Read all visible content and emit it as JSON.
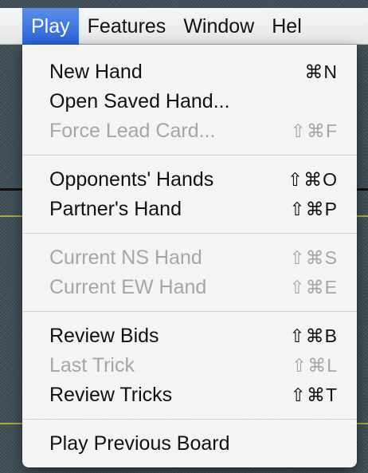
{
  "menubar": {
    "items": [
      {
        "label": "Play",
        "active": true
      },
      {
        "label": "Features"
      },
      {
        "label": "Window"
      },
      {
        "label": "Hel"
      }
    ]
  },
  "menu": {
    "groups": [
      [
        {
          "label": "New Hand",
          "shortcut": "⌘N",
          "enabled": true
        },
        {
          "label": "Open Saved Hand...",
          "shortcut": "",
          "enabled": true
        },
        {
          "label": "Force Lead Card...",
          "shortcut": "⇧⌘F",
          "enabled": false
        }
      ],
      [
        {
          "label": "Opponents' Hands",
          "shortcut": "⇧⌘O",
          "enabled": true
        },
        {
          "label": "Partner's Hand",
          "shortcut": "⇧⌘P",
          "enabled": true
        }
      ],
      [
        {
          "label": "Current NS Hand",
          "shortcut": "⇧⌘S",
          "enabled": false
        },
        {
          "label": "Current EW Hand",
          "shortcut": "⇧⌘E",
          "enabled": false
        }
      ],
      [
        {
          "label": "Review Bids",
          "shortcut": "⇧⌘B",
          "enabled": true
        },
        {
          "label": "Last Trick",
          "shortcut": "⇧⌘L",
          "enabled": false
        },
        {
          "label": "Review Tricks",
          "shortcut": "⇧⌘T",
          "enabled": true
        }
      ],
      [
        {
          "label": "Play Previous Board",
          "shortcut": "",
          "enabled": true
        }
      ]
    ]
  },
  "colors": {
    "menu_highlight": "#2a62d8",
    "disabled_text": "#a6a6a6",
    "enabled_text": "#111111"
  }
}
